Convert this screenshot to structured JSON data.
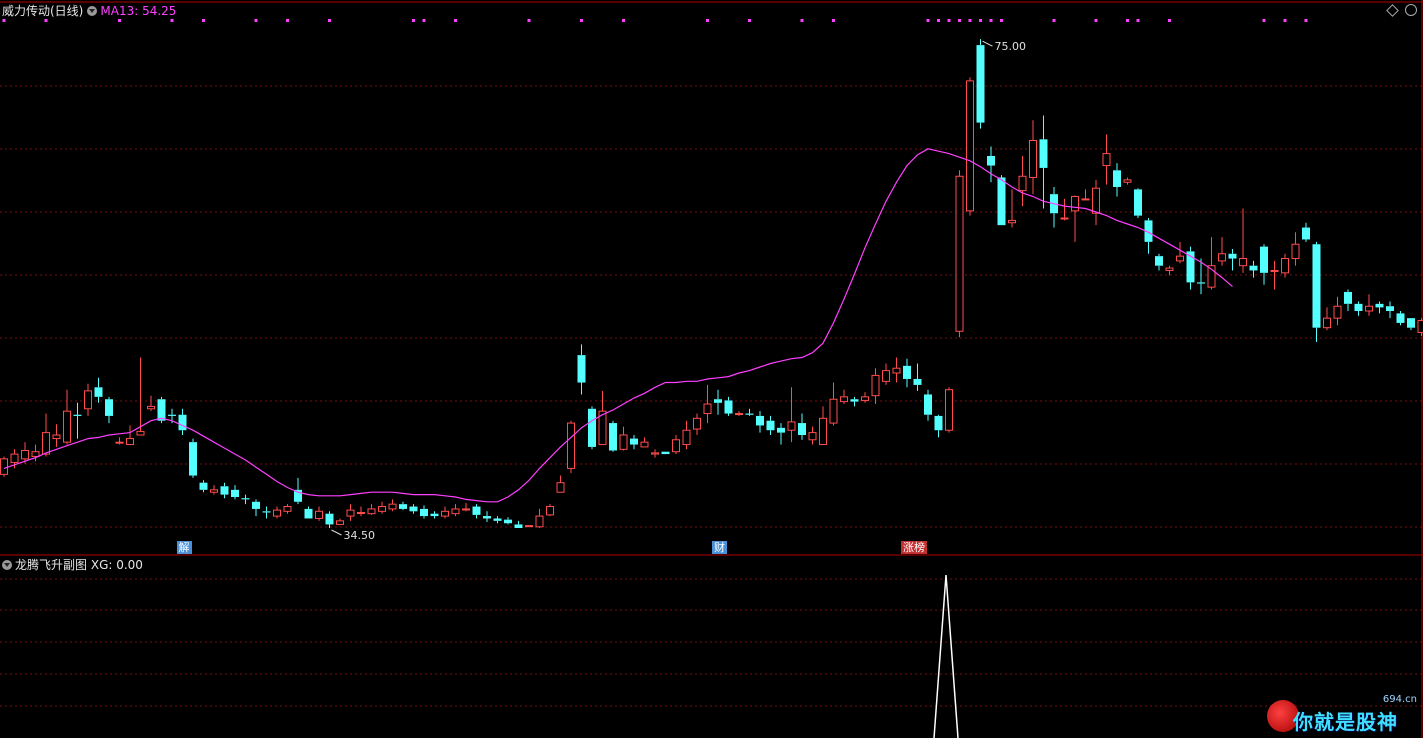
{
  "header": {
    "stock": "威力传动(日线)",
    "ma_label": "MA13: 54.25"
  },
  "sub_header": {
    "indicator": "龙腾飞升副图",
    "xg_label": "XG: 0.00"
  },
  "tags": [
    {
      "text": "解",
      "color": "#4a90d9"
    },
    {
      "text": "财",
      "color": "#4a90d9"
    },
    {
      "text": "涨榜",
      "color": "#c03030"
    }
  ],
  "watermark": {
    "text": "你就是股神",
    "site": "694.cn"
  },
  "colors": {
    "up": "#ff4d4d",
    "down": "#54ffff",
    "ma": "#ff40ff",
    "grid": "#7a1010",
    "border": "#b00000",
    "signal": "#ffffff",
    "marker": "#ff40ff"
  },
  "chart_data": [
    {
      "type": "candlestick",
      "annotations": {
        "high": "75.00",
        "low": "34.50"
      },
      "ma": {
        "name": "MA13",
        "values": [
          39.0,
          39.3,
          39.6,
          39.9,
          40.3,
          40.6,
          40.9,
          41.2,
          41.5,
          41.6,
          41.8,
          41.9,
          42.0,
          42.5,
          43.0,
          43.2,
          43.0,
          42.6,
          42.2,
          41.7,
          41.2,
          40.7,
          40.2,
          39.7,
          39.1,
          38.5,
          37.9,
          37.4,
          37.0,
          36.8,
          36.7,
          36.7,
          36.7,
          36.8,
          36.9,
          37.0,
          37.0,
          37.0,
          36.9,
          36.8,
          36.8,
          36.8,
          36.7,
          36.6,
          36.4,
          36.3,
          36.2,
          36.2,
          36.6,
          37.2,
          38.0,
          39.0,
          39.9,
          40.8,
          41.6,
          42.4,
          43.0,
          43.5,
          43.9,
          44.4,
          44.9,
          45.3,
          45.8,
          46.2,
          46.2,
          46.3,
          46.3,
          46.5,
          46.6,
          46.7,
          47.0,
          47.2,
          47.5,
          47.8,
          48.0,
          48.2,
          48.3,
          48.7,
          49.5,
          51.2,
          53.2,
          55.3,
          57.5,
          59.5,
          61.4,
          63.0,
          64.4,
          65.3,
          65.8,
          65.6,
          65.4,
          65.1,
          64.8,
          64.3,
          63.7,
          63.2,
          62.6,
          62.1,
          61.8,
          61.4,
          61.2,
          61.0,
          60.9,
          60.8,
          60.5,
          60.2,
          59.8,
          59.5,
          59.2,
          58.8,
          58.3,
          57.8,
          57.3,
          56.8,
          56.3,
          55.7,
          55.0,
          54.25
        ]
      },
      "candles": [
        [
          38.5,
          39.8,
          40.0,
          38.3
        ],
        [
          39.5,
          40.2,
          40.6,
          39.0
        ],
        [
          39.8,
          40.5,
          41.2,
          39.4
        ],
        [
          40.0,
          40.4,
          41.0,
          39.6
        ],
        [
          40.2,
          42.0,
          43.6,
          40.0
        ],
        [
          41.5,
          41.8,
          42.7,
          40.8
        ],
        [
          41.2,
          43.8,
          45.6,
          41.0
        ],
        [
          43.5,
          43.4,
          44.5,
          41.5
        ],
        [
          44.0,
          45.5,
          46.1,
          43.4
        ],
        [
          45.8,
          45.0,
          46.6,
          44.5
        ],
        [
          44.8,
          43.4,
          45.0,
          42.8
        ],
        [
          41.2,
          41.2,
          41.6,
          41.0
        ],
        [
          41.0,
          41.5,
          42.6,
          41.0
        ],
        [
          41.8,
          42.1,
          48.3,
          41.8
        ],
        [
          44.0,
          44.2,
          45.1,
          43.8
        ],
        [
          44.8,
          43.0,
          45.0,
          42.8
        ],
        [
          43.5,
          43.4,
          44.0,
          42.8
        ],
        [
          43.5,
          42.2,
          44.0,
          41.8
        ],
        [
          41.2,
          38.4,
          41.5,
          38.2
        ],
        [
          37.8,
          37.2,
          38.0,
          37.0
        ],
        [
          37.0,
          37.2,
          37.6,
          36.8
        ],
        [
          37.5,
          36.8,
          37.8,
          36.5
        ],
        [
          37.2,
          36.6,
          37.6,
          36.4
        ],
        [
          36.5,
          36.4,
          36.8,
          36.0
        ],
        [
          36.2,
          35.6,
          36.4,
          35.0
        ],
        [
          35.4,
          35.3,
          35.8,
          34.8
        ],
        [
          35.0,
          35.5,
          35.8,
          34.8
        ],
        [
          35.4,
          35.8,
          36.0,
          35.2
        ],
        [
          37.2,
          36.2,
          38.2,
          36.0
        ],
        [
          35.6,
          34.8,
          35.8,
          34.8
        ],
        [
          34.8,
          35.4,
          35.8,
          34.6
        ],
        [
          35.2,
          34.3,
          35.4,
          34.0
        ],
        [
          34.3,
          34.6,
          34.8,
          34.5
        ],
        [
          35.0,
          35.5,
          36.0,
          34.6
        ],
        [
          35.3,
          35.3,
          35.8,
          35.0
        ],
        [
          35.2,
          35.6,
          36.0,
          35.1
        ],
        [
          35.4,
          35.8,
          36.2,
          35.2
        ],
        [
          35.6,
          36.0,
          36.4,
          35.4
        ],
        [
          36.0,
          35.6,
          36.2,
          35.5
        ],
        [
          35.8,
          35.4,
          36.0,
          35.2
        ],
        [
          35.6,
          35.0,
          35.9,
          34.8
        ],
        [
          35.2,
          35.0,
          35.4,
          34.8
        ],
        [
          35.0,
          35.4,
          35.8,
          34.8
        ],
        [
          35.2,
          35.6,
          36.0,
          35.0
        ],
        [
          35.6,
          35.6,
          36.1,
          35.4
        ],
        [
          35.8,
          35.1,
          36.0,
          34.8
        ],
        [
          35.0,
          34.8,
          35.4,
          34.5
        ],
        [
          34.8,
          34.6,
          35.0,
          34.4
        ],
        [
          34.7,
          34.4,
          34.9,
          34.3
        ],
        [
          34.3,
          34.0,
          34.6,
          34.0
        ],
        [
          34.2,
          34.2,
          34.2,
          34.1
        ],
        [
          34.1,
          35.0,
          35.6,
          34.0
        ],
        [
          35.1,
          35.8,
          36.0,
          35.0
        ],
        [
          37.0,
          37.8,
          38.4,
          37.0
        ],
        [
          39.0,
          42.8,
          43.0,
          38.6
        ],
        [
          48.5,
          46.2,
          49.4,
          45.2
        ],
        [
          44.0,
          40.8,
          44.2,
          40.6
        ],
        [
          41.0,
          43.8,
          45.5,
          41.0
        ],
        [
          42.8,
          40.5,
          43.0,
          40.4
        ],
        [
          40.6,
          41.8,
          42.5,
          40.5
        ],
        [
          41.5,
          41.0,
          41.8,
          40.6
        ],
        [
          40.8,
          41.2,
          41.6,
          40.8
        ],
        [
          40.2,
          40.3,
          40.6,
          39.9
        ],
        [
          40.4,
          40.2,
          40.4,
          40.2
        ],
        [
          40.4,
          41.4,
          41.8,
          40.2
        ],
        [
          41.0,
          42.2,
          43.0,
          40.6
        ],
        [
          42.3,
          43.2,
          43.6,
          41.8
        ],
        [
          43.6,
          44.4,
          46.0,
          42.8
        ],
        [
          44.8,
          44.5,
          45.6,
          43.5
        ],
        [
          44.7,
          43.6,
          45.0,
          43.4
        ],
        [
          43.6,
          43.6,
          43.8,
          43.4
        ],
        [
          43.6,
          43.5,
          44.0,
          43.4
        ],
        [
          43.4,
          42.6,
          43.8,
          42.0
        ],
        [
          43.0,
          42.2,
          43.4,
          41.8
        ],
        [
          42.4,
          42.0,
          42.8,
          41.0
        ],
        [
          42.2,
          42.9,
          45.8,
          41.2
        ],
        [
          42.8,
          41.8,
          43.6,
          41.4
        ],
        [
          41.4,
          42.0,
          42.5,
          41.0
        ],
        [
          41.0,
          43.2,
          44.2,
          41.0
        ],
        [
          42.8,
          44.8,
          46.2,
          42.6
        ],
        [
          44.6,
          45.0,
          45.6,
          44.4
        ],
        [
          44.8,
          44.6,
          45.0,
          44.2
        ],
        [
          44.7,
          45.0,
          45.4,
          44.5
        ],
        [
          45.1,
          46.8,
          47.4,
          44.4
        ],
        [
          46.3,
          47.2,
          47.8,
          46.0
        ],
        [
          47.0,
          47.4,
          48.3,
          46.2
        ],
        [
          47.6,
          46.5,
          48.2,
          45.8
        ],
        [
          46.5,
          46.0,
          47.8,
          45.5
        ],
        [
          45.2,
          43.5,
          45.6,
          43.0
        ],
        [
          43.4,
          42.2,
          43.5,
          41.6
        ],
        [
          42.2,
          45.6,
          45.8,
          42.0
        ],
        [
          50.5,
          63.5,
          64.0,
          50.0
        ],
        [
          60.6,
          71.5,
          71.8,
          60.2
        ],
        [
          74.5,
          68.0,
          75.0,
          67.5
        ],
        [
          65.2,
          64.4,
          66.0,
          63.0
        ],
        [
          63.4,
          59.4,
          63.6,
          59.4
        ],
        [
          59.6,
          59.8,
          62.4,
          59.2
        ],
        [
          62.3,
          63.5,
          65.2,
          61.0
        ],
        [
          63.4,
          66.5,
          68.2,
          62.0
        ],
        [
          66.6,
          64.2,
          68.6,
          60.8
        ],
        [
          62.0,
          60.4,
          62.6,
          59.2
        ],
        [
          60.0,
          60.0,
          61.6,
          59.8
        ],
        [
          60.6,
          61.8,
          61.9,
          58.0
        ],
        [
          61.6,
          61.6,
          62.4,
          61.5
        ],
        [
          60.4,
          62.5,
          63.2,
          59.4
        ],
        [
          64.4,
          65.4,
          67.0,
          62.8
        ],
        [
          64.0,
          62.6,
          64.6,
          61.8
        ],
        [
          63.0,
          63.2,
          63.4,
          62.8
        ],
        [
          62.4,
          60.2,
          62.5,
          60.0
        ],
        [
          59.8,
          58.0,
          60.0,
          57.0
        ],
        [
          56.8,
          56.0,
          57.0,
          55.6
        ],
        [
          55.6,
          55.8,
          56.0,
          55.2
        ],
        [
          56.4,
          56.8,
          58.0,
          56.2
        ],
        [
          57.2,
          54.6,
          57.6,
          54.0
        ],
        [
          54.6,
          54.5,
          56.6,
          53.6
        ],
        [
          54.2,
          56.0,
          58.4,
          54.0
        ],
        [
          56.4,
          57.0,
          58.4,
          56.0
        ],
        [
          57.0,
          56.6,
          57.4,
          55.6
        ],
        [
          56.0,
          56.6,
          60.8,
          55.4
        ],
        [
          56.0,
          55.6,
          56.4,
          55.0
        ],
        [
          57.6,
          55.4,
          57.8,
          54.4
        ],
        [
          55.6,
          55.6,
          56.4,
          54.0
        ],
        [
          55.4,
          56.6,
          57.0,
          55.0
        ],
        [
          56.6,
          57.8,
          58.8,
          56.0
        ],
        [
          59.2,
          58.2,
          59.6,
          58.0
        ],
        [
          57.8,
          50.8,
          58.0,
          49.6
        ],
        [
          50.8,
          51.6,
          52.5,
          50.6
        ],
        [
          51.6,
          52.6,
          53.4,
          51.0
        ],
        [
          53.8,
          52.8,
          54.0,
          52.2
        ],
        [
          52.8,
          52.2,
          53.0,
          51.8
        ],
        [
          52.2,
          52.6,
          53.6,
          51.8
        ],
        [
          52.8,
          52.5,
          53.0,
          52.0
        ],
        [
          52.6,
          52.2,
          53.0,
          51.6
        ],
        [
          52.0,
          51.2,
          52.2,
          51.0
        ],
        [
          51.6,
          50.8,
          51.6,
          50.6
        ],
        [
          50.4,
          51.4,
          51.6,
          50.1
        ]
      ],
      "markers": [
        0,
        4,
        11,
        16,
        19,
        24,
        27,
        31,
        39,
        40,
        43,
        50,
        55,
        59,
        67,
        71,
        76,
        79,
        88,
        89,
        90,
        91,
        92,
        93,
        94,
        95,
        100,
        104,
        107,
        108,
        111,
        120,
        122,
        124
      ]
    },
    {
      "type": "line",
      "ylim": [
        0,
        1
      ],
      "values_at": {
        "90": 1
      }
    }
  ]
}
